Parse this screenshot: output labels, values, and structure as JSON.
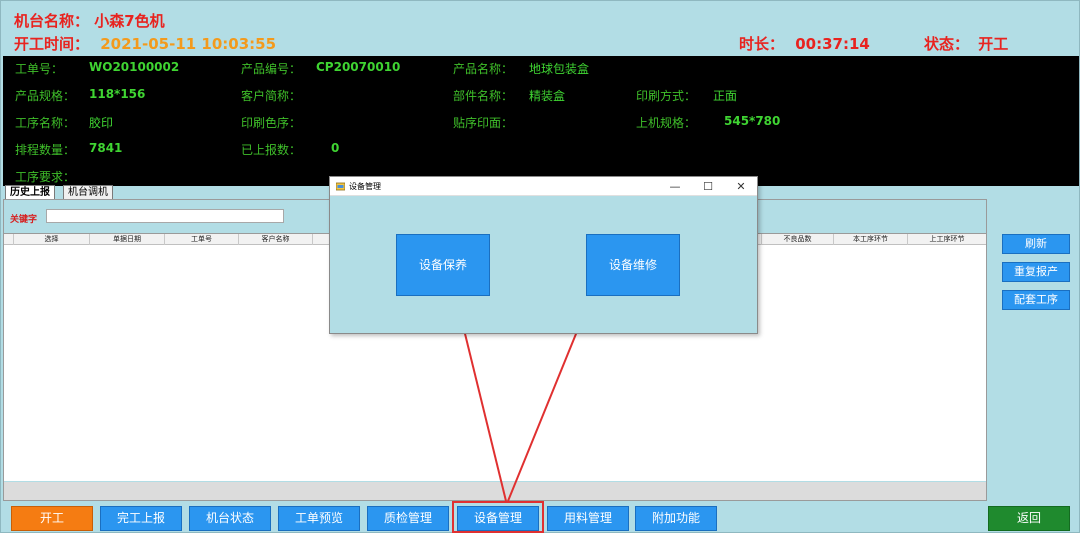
{
  "header": {
    "machine_label": "机台名称：",
    "machine_value": "小森7色机",
    "start_label": "开工时间：",
    "start_value": "2021-05-11 10:03:55",
    "duration_label": "时长：",
    "duration_value": "00:37:14",
    "status_label": "状态：",
    "status_value": "开工"
  },
  "info": {
    "work_order_label": "工单号：",
    "work_order_value": "WO20100002",
    "product_code_label": "产品编号：",
    "product_code_value": "CP20070010",
    "product_name_label": "产品名称：",
    "product_name_value": "地球包装盒",
    "product_spec_label": "产品规格：",
    "product_spec_value": "118*156",
    "customer_label": "客户简称：",
    "customer_value": "",
    "part_name_label": "部件名称：",
    "part_name_value": "精装盒",
    "print_method_label": "印刷方式：",
    "print_method_value": "正面",
    "process_name_label": "工序名称：",
    "process_name_value": "胶印",
    "color_order_label": "印刷色序：",
    "color_order_value": "",
    "mounting_label": "贴序印面：",
    "mounting_value": "",
    "machine_spec_label": "上机规格：",
    "machine_spec_value": "545*780",
    "scheduled_qty_label": "排程数量：",
    "scheduled_qty_value": "7841",
    "reported_qty_label": "已上报数：",
    "reported_qty_value": "0",
    "process_req_label": "工序要求："
  },
  "tabs": [
    "历史上报",
    "机台调机"
  ],
  "search": {
    "label": "关键字",
    "value": ""
  },
  "grid": {
    "columns": [
      "选择",
      "单据日期",
      "工单号",
      "客户名称",
      "",
      "不良品数",
      "本工序环节",
      "上工序环节"
    ]
  },
  "side_buttons": [
    "刷新",
    "重复报产",
    "配套工序"
  ],
  "toolbar": {
    "buttons": [
      "开工",
      "完工上报",
      "机台状态",
      "工单预览",
      "质检管理",
      "设备管理",
      "用料管理",
      "附加功能"
    ],
    "back": "返回"
  },
  "dialog": {
    "title": "设备管理",
    "buttons": [
      "设备保养",
      "设备维修"
    ],
    "controls": {
      "minimize": "—",
      "maximize": "☐",
      "close": "✕"
    }
  },
  "colors": {
    "accent_red": "#e8231f",
    "time_orange": "#f39a1c",
    "button_blue": "#2b96f0",
    "start_orange": "#f57c12",
    "back_green": "#1f8a2e",
    "panel_teal": "#b2dde5",
    "info_green": "#3fd432"
  }
}
